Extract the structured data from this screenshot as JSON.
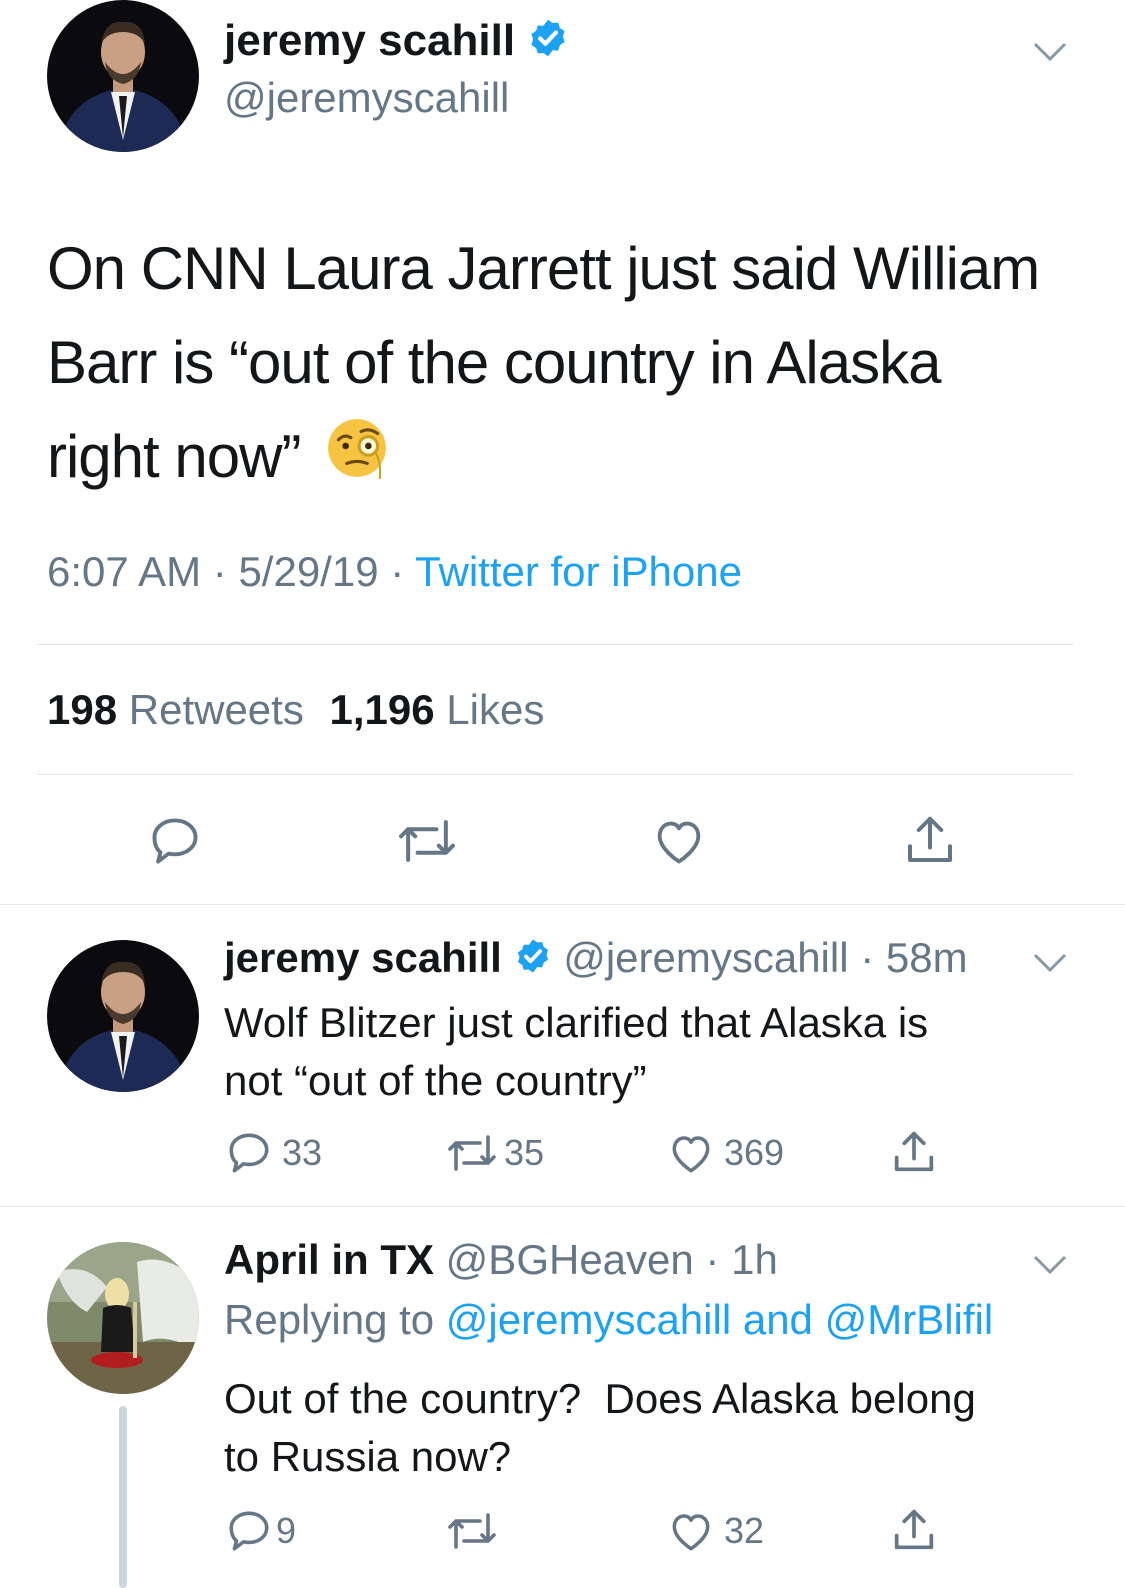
{
  "main_tweet": {
    "author_name": "jeremy scahill",
    "handle": "@jeremyscahill",
    "text_line1": "On CNN Laura Jarrett just said William",
    "text_line2": "Barr is “out of the country in Alaska",
    "text_line3": "right now”",
    "emoji": "face-with-monocle",
    "time": "6:07 AM",
    "sep1": " · ",
    "date": "5/29/19",
    "sep2": " · ",
    "source": "Twitter for iPhone",
    "retweets_count": "198",
    "retweets_label": "Retweets",
    "likes_count": "1,196",
    "likes_label": "Likes",
    "actions": [
      "reply-icon",
      "retweet-icon",
      "like-icon",
      "share-icon"
    ]
  },
  "reply1": {
    "author_name": "jeremy scahill",
    "handle": "@jeremyscahill",
    "sep": " · ",
    "time": "58m",
    "text_line1": "Wolf Blitzer just clarified that Alaska is",
    "text_line2": "not “out of the country”",
    "reply_count": "33",
    "retweet_count": "35",
    "like_count": "369"
  },
  "reply2": {
    "author_name": "April in TX",
    "handle": "@BGHeaven",
    "sep": " · ",
    "time": "1h",
    "replying_to_label": "Replying to",
    "replying_to_users": "@jeremyscahill and @MrBlifil",
    "text_line1": "Out of the country?  Does Alaska belong",
    "text_line2": "to Russia now?",
    "reply_count": "9",
    "like_count": "32"
  },
  "colors": {
    "accent": "#1da1f2",
    "secondary_text": "#657786",
    "divider": "#e1e8ed"
  }
}
